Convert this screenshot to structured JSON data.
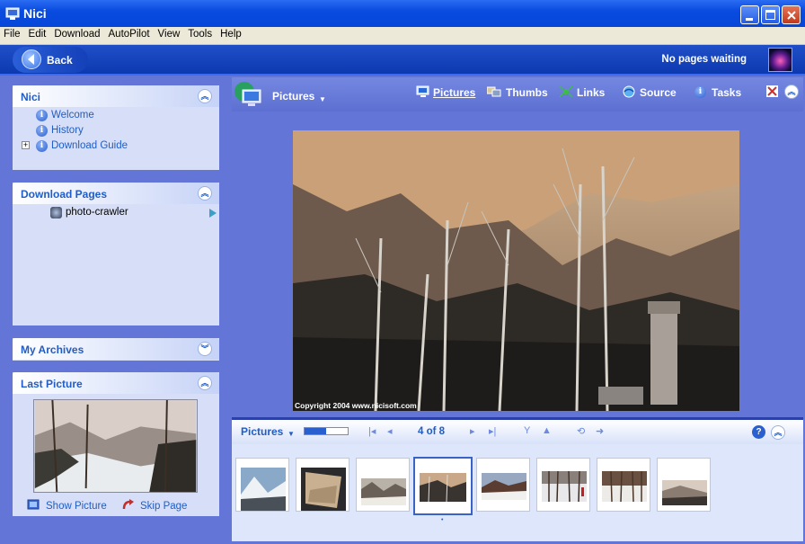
{
  "window": {
    "title": "Nici"
  },
  "menu": [
    "File",
    "Edit",
    "Download",
    "AutoPilot",
    "View",
    "Tools",
    "Help"
  ],
  "toolbar": {
    "back_label": "Back",
    "status": "No pages waiting"
  },
  "panels": {
    "nici": {
      "title": "Nici",
      "items": [
        "Welcome",
        "History",
        "Download Guide"
      ]
    },
    "download_pages": {
      "title": "Download Pages",
      "item": "photo-crawler"
    },
    "archives": {
      "title": "My Archives"
    },
    "last_picture": {
      "title": "Last Picture",
      "show_label": "Show Picture",
      "skip_label": "Skip Page"
    }
  },
  "viewer": {
    "section_label": "Pictures",
    "tabs": [
      "Pictures",
      "Thumbs",
      "Links",
      "Source",
      "Tasks"
    ],
    "active_tab": "Pictures",
    "copyright": "Copyright 2004 www.nicisoft.com"
  },
  "strip": {
    "label": "Pictures",
    "position": "4 of 8",
    "current": 4,
    "total": 8,
    "selected_index": 3
  },
  "colors": {
    "titlebar": "#0a4be0",
    "panel_bg": "#d6dff7",
    "link": "#215dc6",
    "workspace": "#6375d6"
  }
}
